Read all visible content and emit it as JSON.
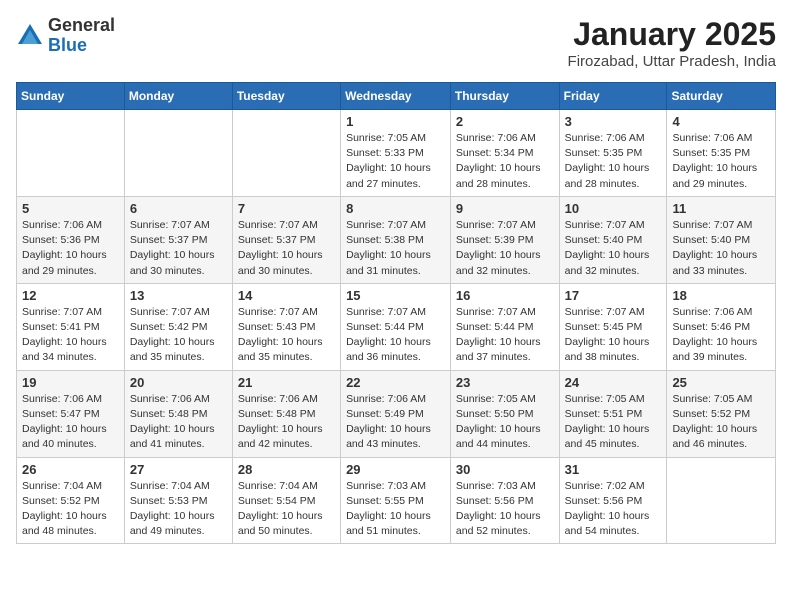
{
  "logo": {
    "general": "General",
    "blue": "Blue"
  },
  "header": {
    "month": "January 2025",
    "location": "Firozabad, Uttar Pradesh, India"
  },
  "days_of_week": [
    "Sunday",
    "Monday",
    "Tuesday",
    "Wednesday",
    "Thursday",
    "Friday",
    "Saturday"
  ],
  "weeks": [
    [
      {
        "day": "",
        "info": ""
      },
      {
        "day": "",
        "info": ""
      },
      {
        "day": "",
        "info": ""
      },
      {
        "day": "1",
        "info": "Sunrise: 7:05 AM\nSunset: 5:33 PM\nDaylight: 10 hours\nand 27 minutes."
      },
      {
        "day": "2",
        "info": "Sunrise: 7:06 AM\nSunset: 5:34 PM\nDaylight: 10 hours\nand 28 minutes."
      },
      {
        "day": "3",
        "info": "Sunrise: 7:06 AM\nSunset: 5:35 PM\nDaylight: 10 hours\nand 28 minutes."
      },
      {
        "day": "4",
        "info": "Sunrise: 7:06 AM\nSunset: 5:35 PM\nDaylight: 10 hours\nand 29 minutes."
      }
    ],
    [
      {
        "day": "5",
        "info": "Sunrise: 7:06 AM\nSunset: 5:36 PM\nDaylight: 10 hours\nand 29 minutes."
      },
      {
        "day": "6",
        "info": "Sunrise: 7:07 AM\nSunset: 5:37 PM\nDaylight: 10 hours\nand 30 minutes."
      },
      {
        "day": "7",
        "info": "Sunrise: 7:07 AM\nSunset: 5:37 PM\nDaylight: 10 hours\nand 30 minutes."
      },
      {
        "day": "8",
        "info": "Sunrise: 7:07 AM\nSunset: 5:38 PM\nDaylight: 10 hours\nand 31 minutes."
      },
      {
        "day": "9",
        "info": "Sunrise: 7:07 AM\nSunset: 5:39 PM\nDaylight: 10 hours\nand 32 minutes."
      },
      {
        "day": "10",
        "info": "Sunrise: 7:07 AM\nSunset: 5:40 PM\nDaylight: 10 hours\nand 32 minutes."
      },
      {
        "day": "11",
        "info": "Sunrise: 7:07 AM\nSunset: 5:40 PM\nDaylight: 10 hours\nand 33 minutes."
      }
    ],
    [
      {
        "day": "12",
        "info": "Sunrise: 7:07 AM\nSunset: 5:41 PM\nDaylight: 10 hours\nand 34 minutes."
      },
      {
        "day": "13",
        "info": "Sunrise: 7:07 AM\nSunset: 5:42 PM\nDaylight: 10 hours\nand 35 minutes."
      },
      {
        "day": "14",
        "info": "Sunrise: 7:07 AM\nSunset: 5:43 PM\nDaylight: 10 hours\nand 35 minutes."
      },
      {
        "day": "15",
        "info": "Sunrise: 7:07 AM\nSunset: 5:44 PM\nDaylight: 10 hours\nand 36 minutes."
      },
      {
        "day": "16",
        "info": "Sunrise: 7:07 AM\nSunset: 5:44 PM\nDaylight: 10 hours\nand 37 minutes."
      },
      {
        "day": "17",
        "info": "Sunrise: 7:07 AM\nSunset: 5:45 PM\nDaylight: 10 hours\nand 38 minutes."
      },
      {
        "day": "18",
        "info": "Sunrise: 7:06 AM\nSunset: 5:46 PM\nDaylight: 10 hours\nand 39 minutes."
      }
    ],
    [
      {
        "day": "19",
        "info": "Sunrise: 7:06 AM\nSunset: 5:47 PM\nDaylight: 10 hours\nand 40 minutes."
      },
      {
        "day": "20",
        "info": "Sunrise: 7:06 AM\nSunset: 5:48 PM\nDaylight: 10 hours\nand 41 minutes."
      },
      {
        "day": "21",
        "info": "Sunrise: 7:06 AM\nSunset: 5:48 PM\nDaylight: 10 hours\nand 42 minutes."
      },
      {
        "day": "22",
        "info": "Sunrise: 7:06 AM\nSunset: 5:49 PM\nDaylight: 10 hours\nand 43 minutes."
      },
      {
        "day": "23",
        "info": "Sunrise: 7:05 AM\nSunset: 5:50 PM\nDaylight: 10 hours\nand 44 minutes."
      },
      {
        "day": "24",
        "info": "Sunrise: 7:05 AM\nSunset: 5:51 PM\nDaylight: 10 hours\nand 45 minutes."
      },
      {
        "day": "25",
        "info": "Sunrise: 7:05 AM\nSunset: 5:52 PM\nDaylight: 10 hours\nand 46 minutes."
      }
    ],
    [
      {
        "day": "26",
        "info": "Sunrise: 7:04 AM\nSunset: 5:52 PM\nDaylight: 10 hours\nand 48 minutes."
      },
      {
        "day": "27",
        "info": "Sunrise: 7:04 AM\nSunset: 5:53 PM\nDaylight: 10 hours\nand 49 minutes."
      },
      {
        "day": "28",
        "info": "Sunrise: 7:04 AM\nSunset: 5:54 PM\nDaylight: 10 hours\nand 50 minutes."
      },
      {
        "day": "29",
        "info": "Sunrise: 7:03 AM\nSunset: 5:55 PM\nDaylight: 10 hours\nand 51 minutes."
      },
      {
        "day": "30",
        "info": "Sunrise: 7:03 AM\nSunset: 5:56 PM\nDaylight: 10 hours\nand 52 minutes."
      },
      {
        "day": "31",
        "info": "Sunrise: 7:02 AM\nSunset: 5:56 PM\nDaylight: 10 hours\nand 54 minutes."
      },
      {
        "day": "",
        "info": ""
      }
    ]
  ]
}
